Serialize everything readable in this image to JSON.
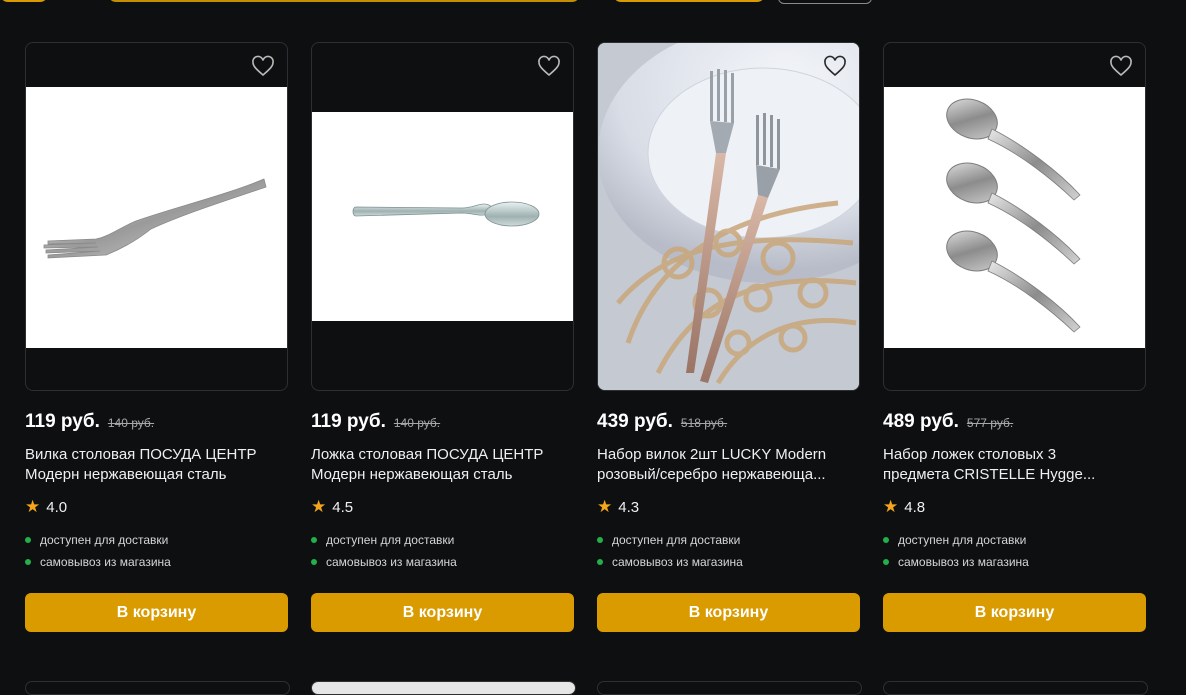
{
  "colors": {
    "accent": "#d99b00",
    "available_dot": "#23b04a",
    "star": "#f4a51c"
  },
  "products": [
    {
      "price": "119 руб.",
      "old_price": "140 руб.",
      "title_line1": "Вилка столовая ПОСУДА ЦЕНТР",
      "title_line2": "Модерн нержавеющая сталь",
      "rating": "4.0",
      "delivery": "доступен для доставки",
      "pickup": "самовывоз из магазина",
      "button": "В корзину",
      "image": "fork-icon"
    },
    {
      "price": "119 руб.",
      "old_price": "140 руб.",
      "title_line1": "Ложка столовая ПОСУДА ЦЕНТР",
      "title_line2": "Модерн нержавеющая сталь",
      "rating": "4.5",
      "delivery": "доступен для доставки",
      "pickup": "самовывоз из магазина",
      "button": "В корзину",
      "image": "spoon-icon"
    },
    {
      "price": "439 руб.",
      "old_price": "518 руб.",
      "title_line1": "Набор вилок 2шт LUCKY Modern",
      "title_line2": "розовый/серебро нержавеюща...",
      "rating": "4.3",
      "delivery": "доступен для доставки",
      "pickup": "самовывоз из магазина",
      "button": "В корзину",
      "image": "forks-set-photo"
    },
    {
      "price": "489 руб.",
      "old_price": "577 руб.",
      "title_line1": "Набор ложек столовых 3",
      "title_line2": "предмета CRISTELLE Hygge...",
      "rating": "4.8",
      "delivery": "доступен для доставки",
      "pickup": "самовывоз из магазина",
      "button": "В корзину",
      "image": "spoons-set-icon"
    }
  ]
}
